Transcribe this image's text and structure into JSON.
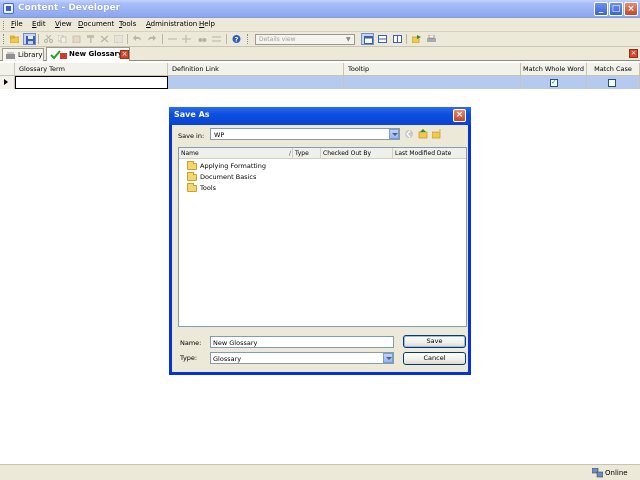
{
  "window": {
    "title": "Content - Developer"
  },
  "menu": [
    "File",
    "Edit",
    "View",
    "Document",
    "Tools",
    "Administration",
    "Help"
  ],
  "toolbar": {
    "view_placeholder": "Details view"
  },
  "tabs": [
    {
      "label": "Library",
      "active": false
    },
    {
      "label": "New Glossary",
      "active": true
    }
  ],
  "grid": {
    "columns": [
      "Glossary Term",
      "Definition Link",
      "Tooltip",
      "Match Whole Word",
      "Match Case"
    ],
    "row": {
      "match_whole_word": true,
      "match_case": false
    }
  },
  "status": {
    "text": "Online"
  },
  "dialog": {
    "title": "Save As",
    "save_in_label": "Save in:",
    "save_in_value": "WP",
    "columns": [
      "Name",
      "Type",
      "Checked Out By",
      "Last Modified Date"
    ],
    "items": [
      "Applying Formatting",
      "Document Basics",
      "Tools"
    ],
    "name_label": "Name:",
    "name_value": "New Glossary",
    "type_label": "Type:",
    "type_value": "Glossary",
    "save_button": "Save",
    "cancel_button": "Cancel"
  },
  "colors": {
    "accent": "#0831d9",
    "selection": "#b6c9ef",
    "chrome": "#ece9d8"
  }
}
